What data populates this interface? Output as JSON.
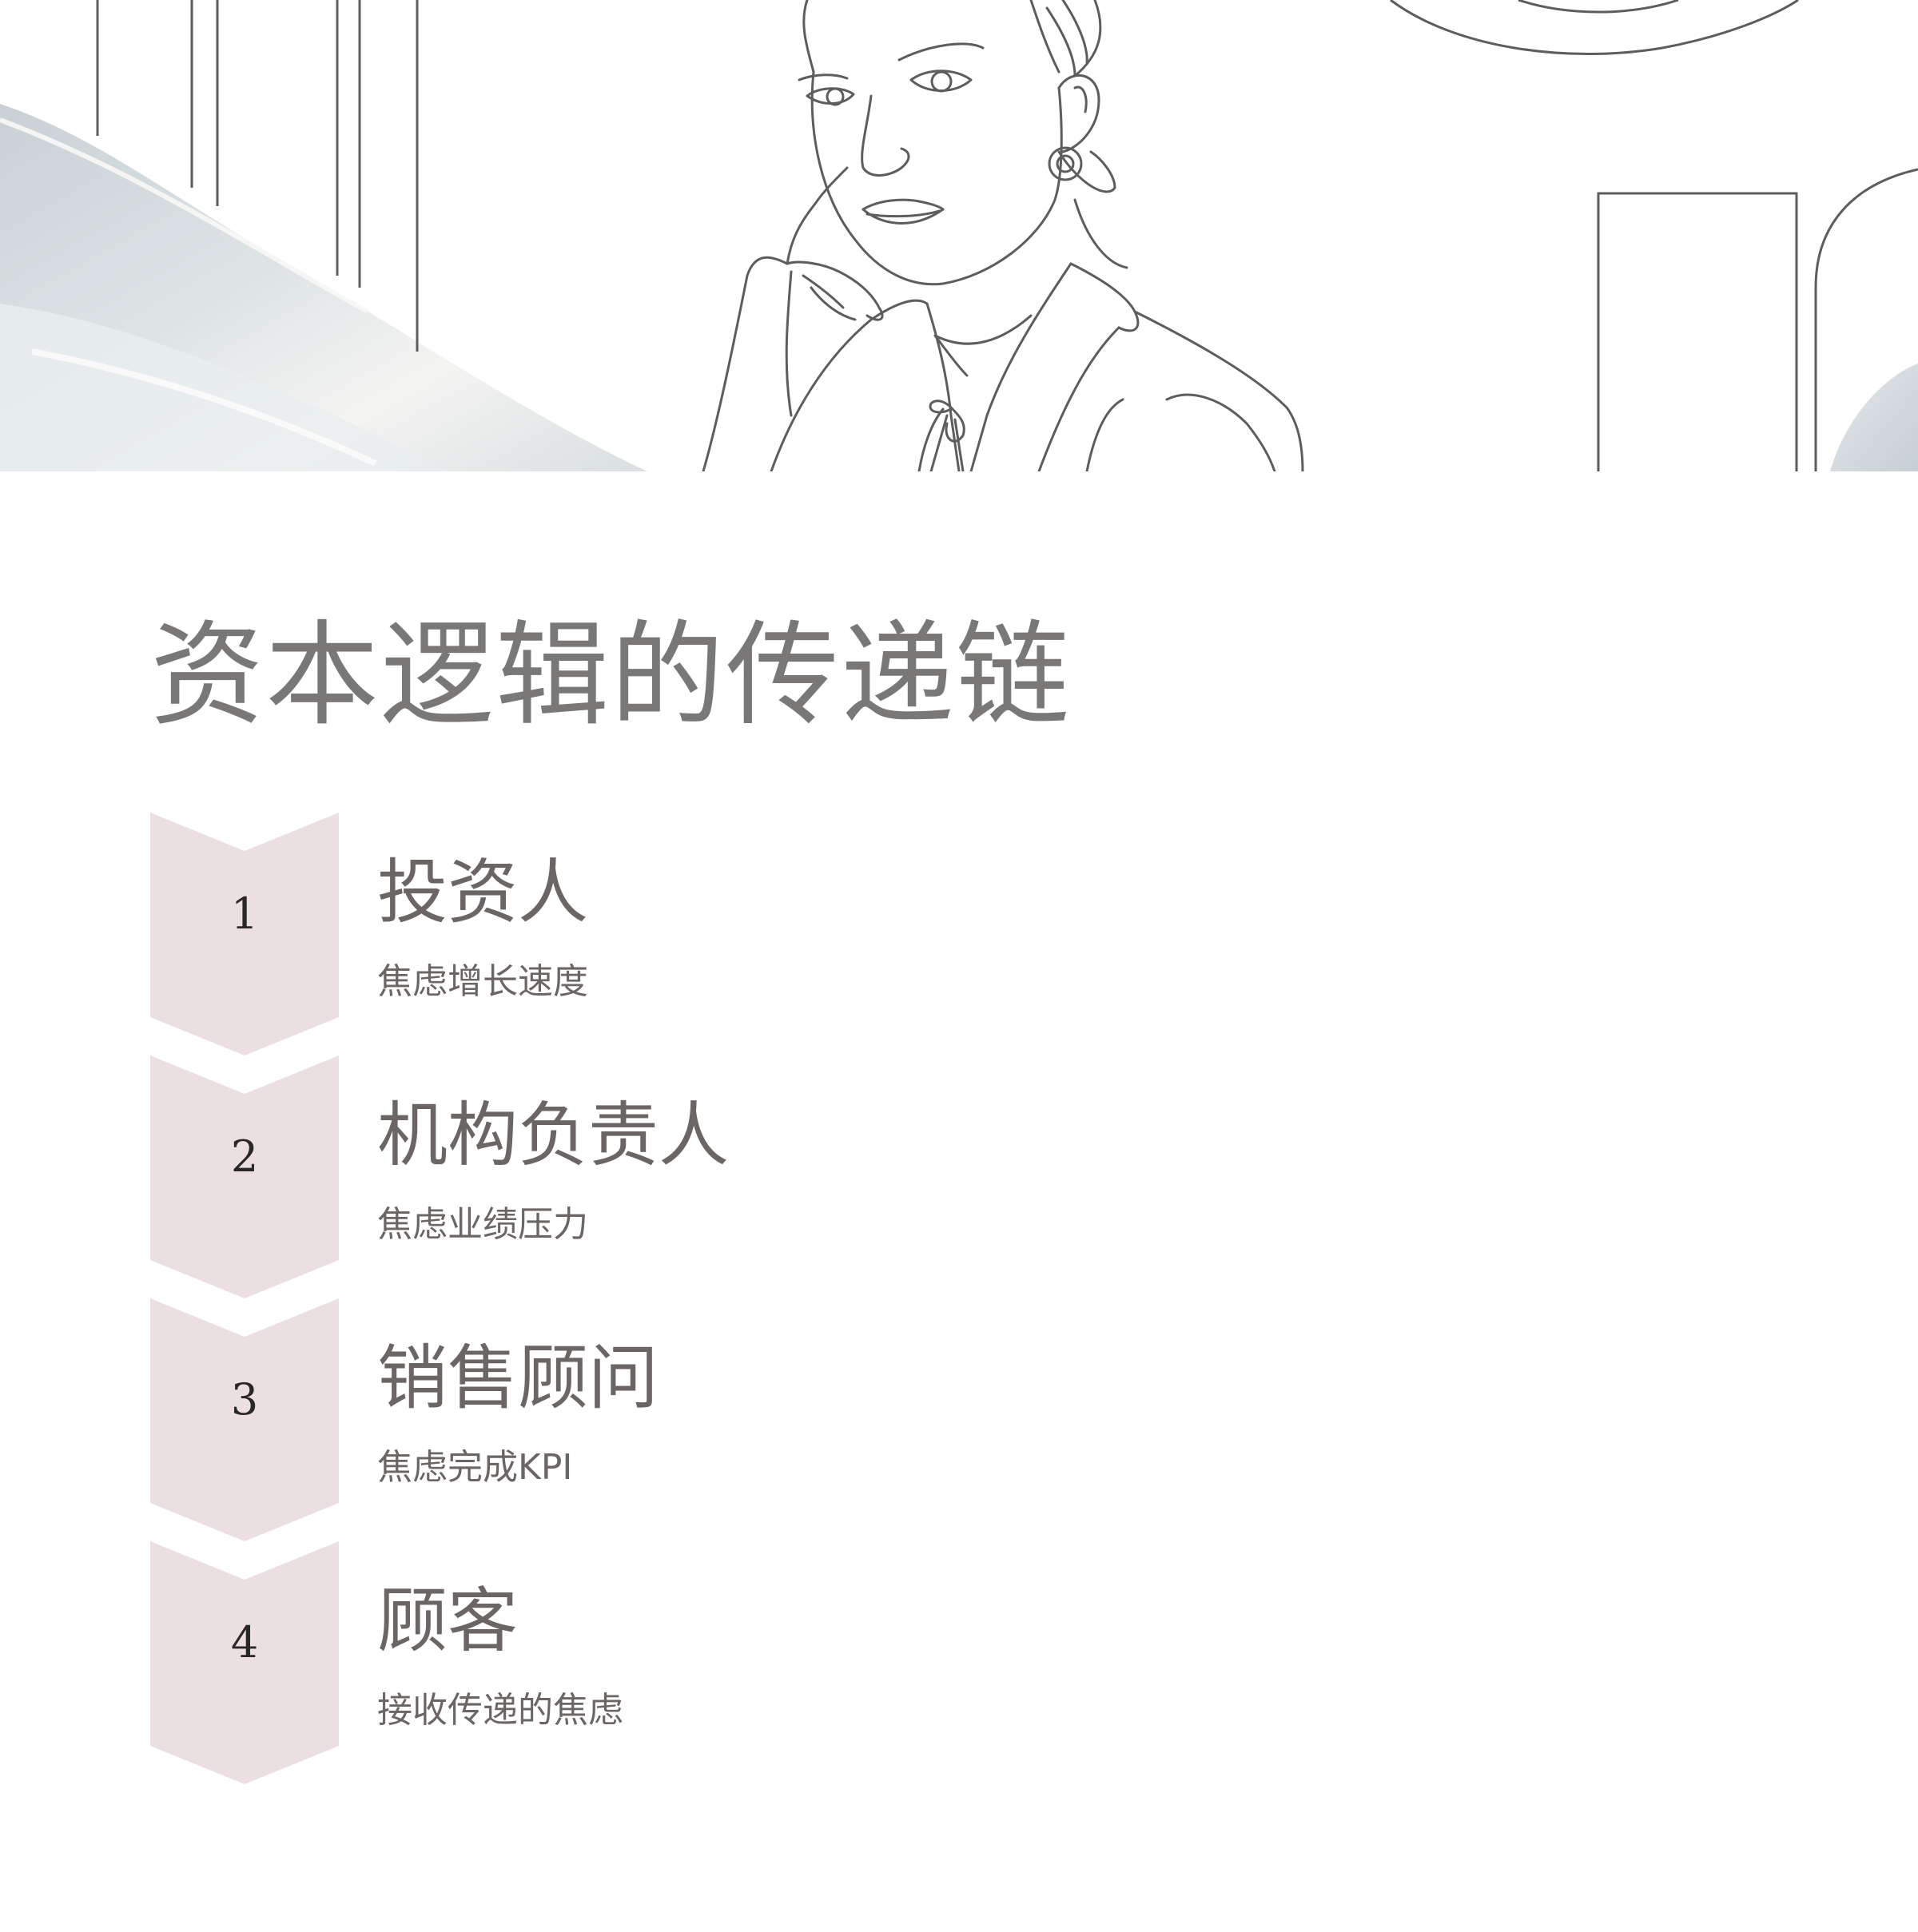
{
  "title": "资本逻辑的传递链",
  "colors": {
    "chevron_fill": "#ebdfe2",
    "title_text": "#7a7877",
    "body_text": "#6b6564",
    "number_text": "#2a2727",
    "line_art": "#5e5c5c"
  },
  "steps": [
    {
      "number": "1",
      "title": "投资人",
      "description": "焦虑增长速度"
    },
    {
      "number": "2",
      "title": "机构负责人",
      "description": "焦虑业绩压力"
    },
    {
      "number": "3",
      "title": "销售顾问",
      "description": "焦虑完成KPI"
    },
    {
      "number": "4",
      "title": "顾客",
      "description": "接收传递的焦虑"
    }
  ]
}
